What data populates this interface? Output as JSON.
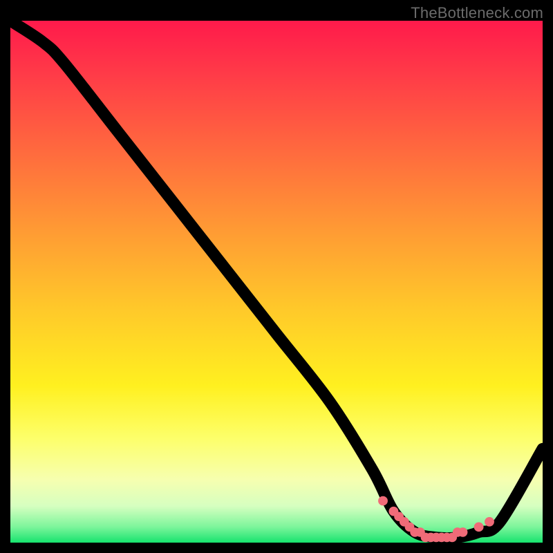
{
  "watermark": "TheBottleneck.com",
  "colors": {
    "gradient_top": "#ff1a4b",
    "gradient_mid1": "#ff9a34",
    "gradient_mid2": "#fff020",
    "gradient_bottom": "#17e36e",
    "curve": "#000000",
    "dots": "#f06b78",
    "frame": "#000000"
  },
  "chart_data": {
    "type": "line",
    "title": "",
    "xlabel": "",
    "ylabel": "",
    "xlim": [
      0,
      100
    ],
    "ylim": [
      0,
      100
    ],
    "grid": false,
    "legend": false,
    "series": [
      {
        "name": "bottleneck-curve",
        "x": [
          0,
          6,
          10,
          20,
          30,
          40,
          50,
          60,
          68,
          72,
          76,
          80,
          84,
          88,
          92,
          100
        ],
        "y": [
          100,
          96,
          92,
          79,
          66,
          53,
          40,
          27,
          14,
          6,
          2,
          1,
          1,
          2,
          4,
          18
        ]
      }
    ],
    "highlight_points": {
      "note": "cluster near the valley bottom plus two slightly past it",
      "x": [
        70,
        72,
        73,
        74,
        75,
        76,
        77,
        78,
        79,
        80,
        81,
        82,
        83,
        84,
        85,
        88,
        90
      ],
      "y": [
        8,
        6,
        5,
        4,
        3,
        2,
        2,
        1,
        1,
        1,
        1,
        1,
        1,
        2,
        2,
        3,
        4
      ]
    }
  }
}
